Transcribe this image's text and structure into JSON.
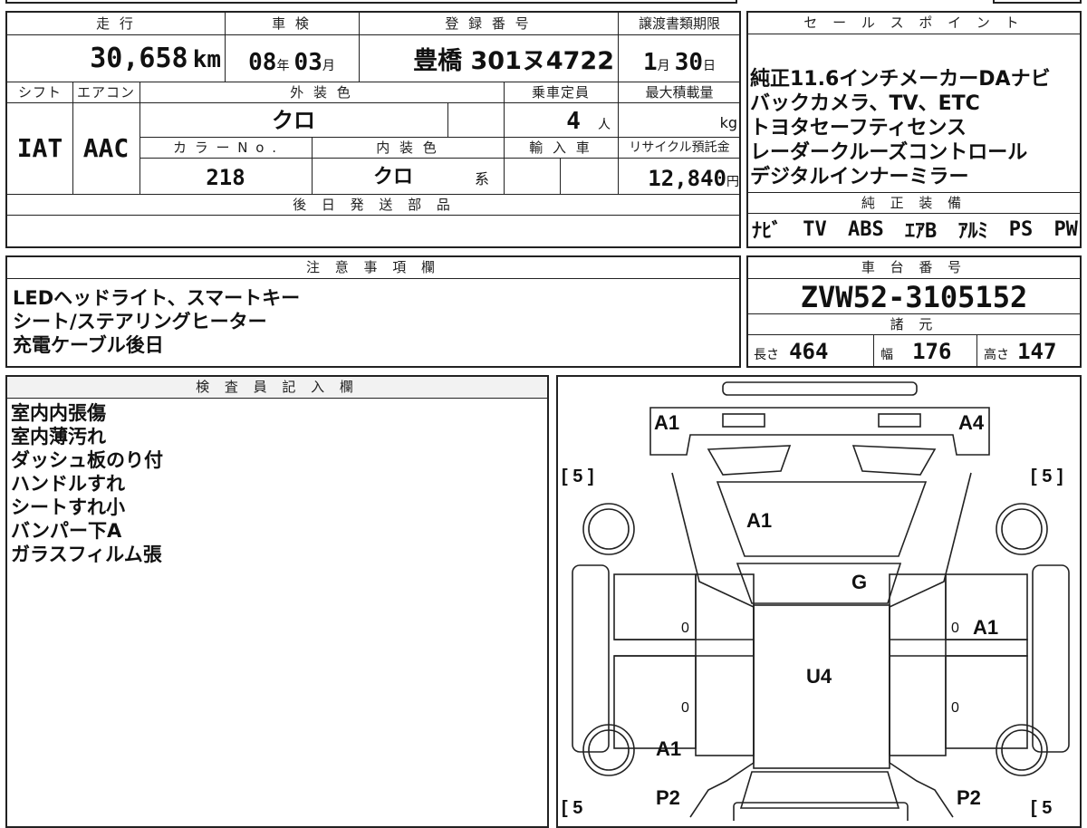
{
  "vehicle": {
    "labels": {
      "mileage": "走 行",
      "inspection": "車 検",
      "registration": "登 録 番 号",
      "transfer_deadline": "譲渡書類期限",
      "shift": "シフト",
      "aircon": "エアコン",
      "exterior_color": "外 装 色",
      "capacity": "乗車定員",
      "max_load": "最大積載量",
      "color_no": "カ ラ ー N o .",
      "interior_color": "内 装 色",
      "import": "輸 入 車",
      "recycle": "リサイクル預託金",
      "later_parts": "後 日 発 送 部 品"
    },
    "mileage_value": "30,658",
    "mileage_unit": "km",
    "inspection_year": "08",
    "inspection_year_unit": "年",
    "inspection_month": "03",
    "inspection_month_unit": "月",
    "registration_value": "豊橋 301ヌ4722",
    "deadline_month": "1",
    "deadline_month_unit": "月",
    "deadline_day": "30",
    "deadline_day_unit": "日",
    "shift_value": "IAT",
    "aircon_value": "AAC",
    "exterior_color_value": "クロ",
    "capacity_value": "4",
    "capacity_unit": "人",
    "max_load_unit": "kg",
    "color_no_value": "218",
    "interior_color_value": "クロ",
    "interior_color_suffix": "系",
    "recycle_value": "12,840",
    "recycle_unit": "円"
  },
  "sales_points": {
    "header": "セ ー ル ス ポ イ ン ト",
    "lines": [
      "純正11.6インチメーカーDAナビ",
      "バックカメラ、TV、ETC",
      "トヨタセーフティセンス",
      "レーダークルーズコントロール",
      "デジタルインナーミラー"
    ]
  },
  "equipment": {
    "header": "純 正 装 備",
    "items": [
      "ﾅﾋﾞ",
      "TV",
      "ABS",
      "ｴｱB",
      "ｱﾙﾐ",
      "PS",
      "PW"
    ]
  },
  "notes": {
    "header": "注 意 事 項 欄",
    "lines": [
      "LEDヘッドライト、スマートキー",
      "シート/ステアリングヒーター",
      "充電ケーブル後日"
    ]
  },
  "chassis": {
    "header": "車 台 番 号",
    "value": "ZVW52-3105152",
    "spec_header": "諸 元",
    "length_label": "長さ",
    "length_value": "464",
    "width_label": "幅",
    "width_value": "176",
    "height_label": "高さ",
    "height_value": "147"
  },
  "inspector": {
    "header": "検 査 員 記 入 欄",
    "lines": [
      "室内内張傷",
      "室内薄汚れ",
      "ダッシュ板のり付",
      "ハンドルすれ",
      "シートすれ小",
      "バンパー下A",
      "ガラスフィルム張"
    ]
  },
  "diagram": {
    "marks": {
      "front_left": "A1",
      "front_right": "A4",
      "hood": "A1",
      "windshield": "G",
      "right_front_door": "A1",
      "roof": "U4",
      "left_rear": "A1",
      "rear_left": "P2",
      "rear_right": "P2"
    },
    "tire_tl": "[ 5 ]",
    "tire_tr": "[ 5 ]",
    "tire_bl": "[ 5",
    "tire_br": "[ 5",
    "door_zero": "0"
  }
}
